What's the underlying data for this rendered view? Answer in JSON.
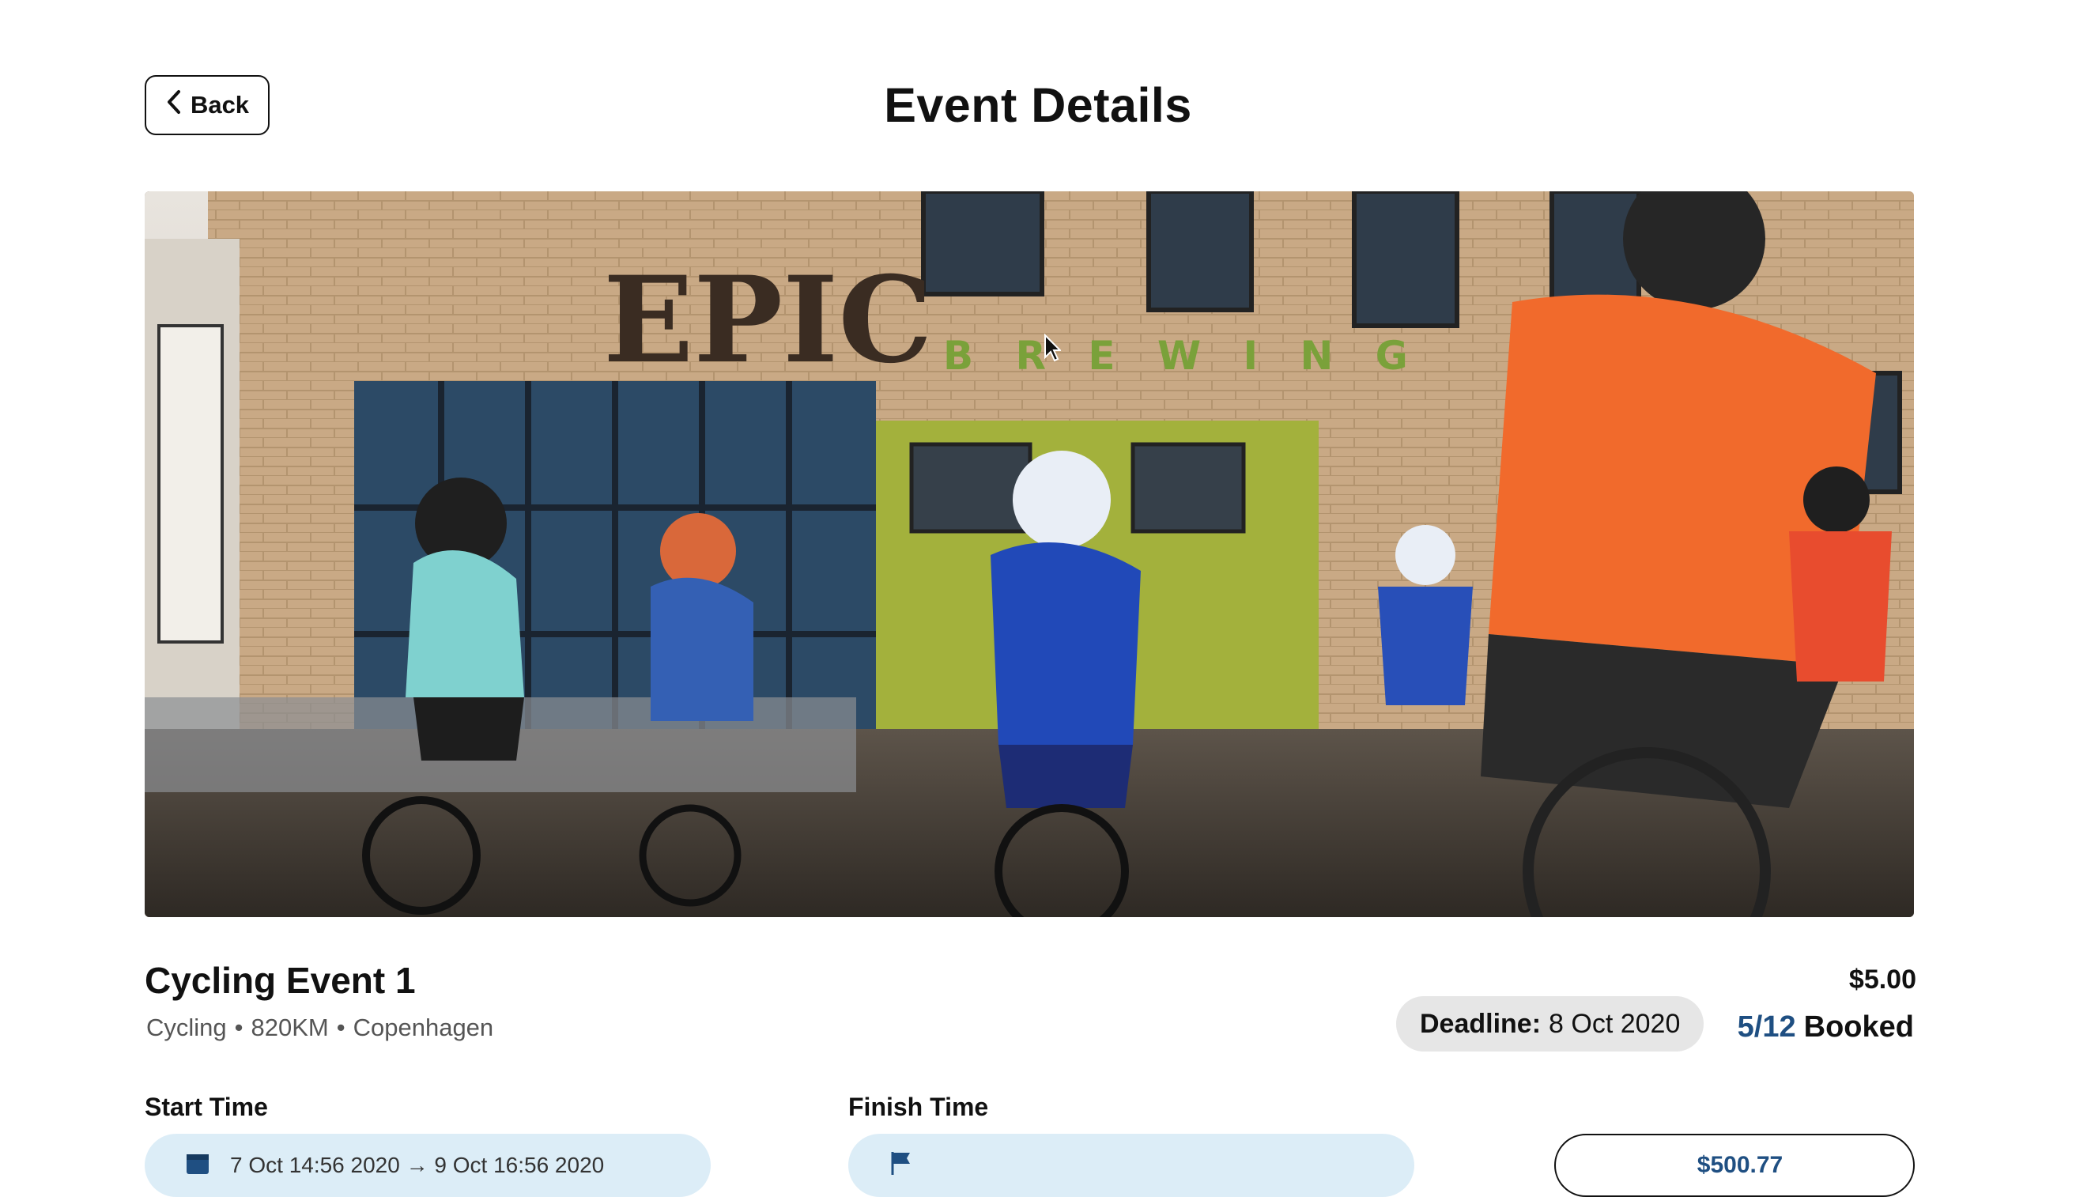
{
  "header": {
    "back_label": "Back",
    "title": "Event Details"
  },
  "hero": {
    "sign_text": "EPIC",
    "sign_subtext": "B R E W I N G"
  },
  "event": {
    "title": "Cycling Event 1",
    "sport": "Cycling",
    "distance": "820KM",
    "location": "Copenhagen",
    "separator": "•",
    "price": "$5.00",
    "deadline_label": "Deadline:",
    "deadline_value": "8 Oct 2020",
    "booked_count": "5/12",
    "booked_label": "Booked"
  },
  "times": {
    "start_label": "Start Time",
    "start_value": "7 Oct 14:56 2020  →  9 Oct 16:56 2020",
    "finish_label": "Finish Time",
    "finish_value": ""
  },
  "book": {
    "label": "",
    "amount": "$500.77"
  },
  "colors": {
    "accent_blue": "#1f4f82",
    "field_bg": "#dcedf7",
    "pill_bg": "#e6e6e6"
  }
}
